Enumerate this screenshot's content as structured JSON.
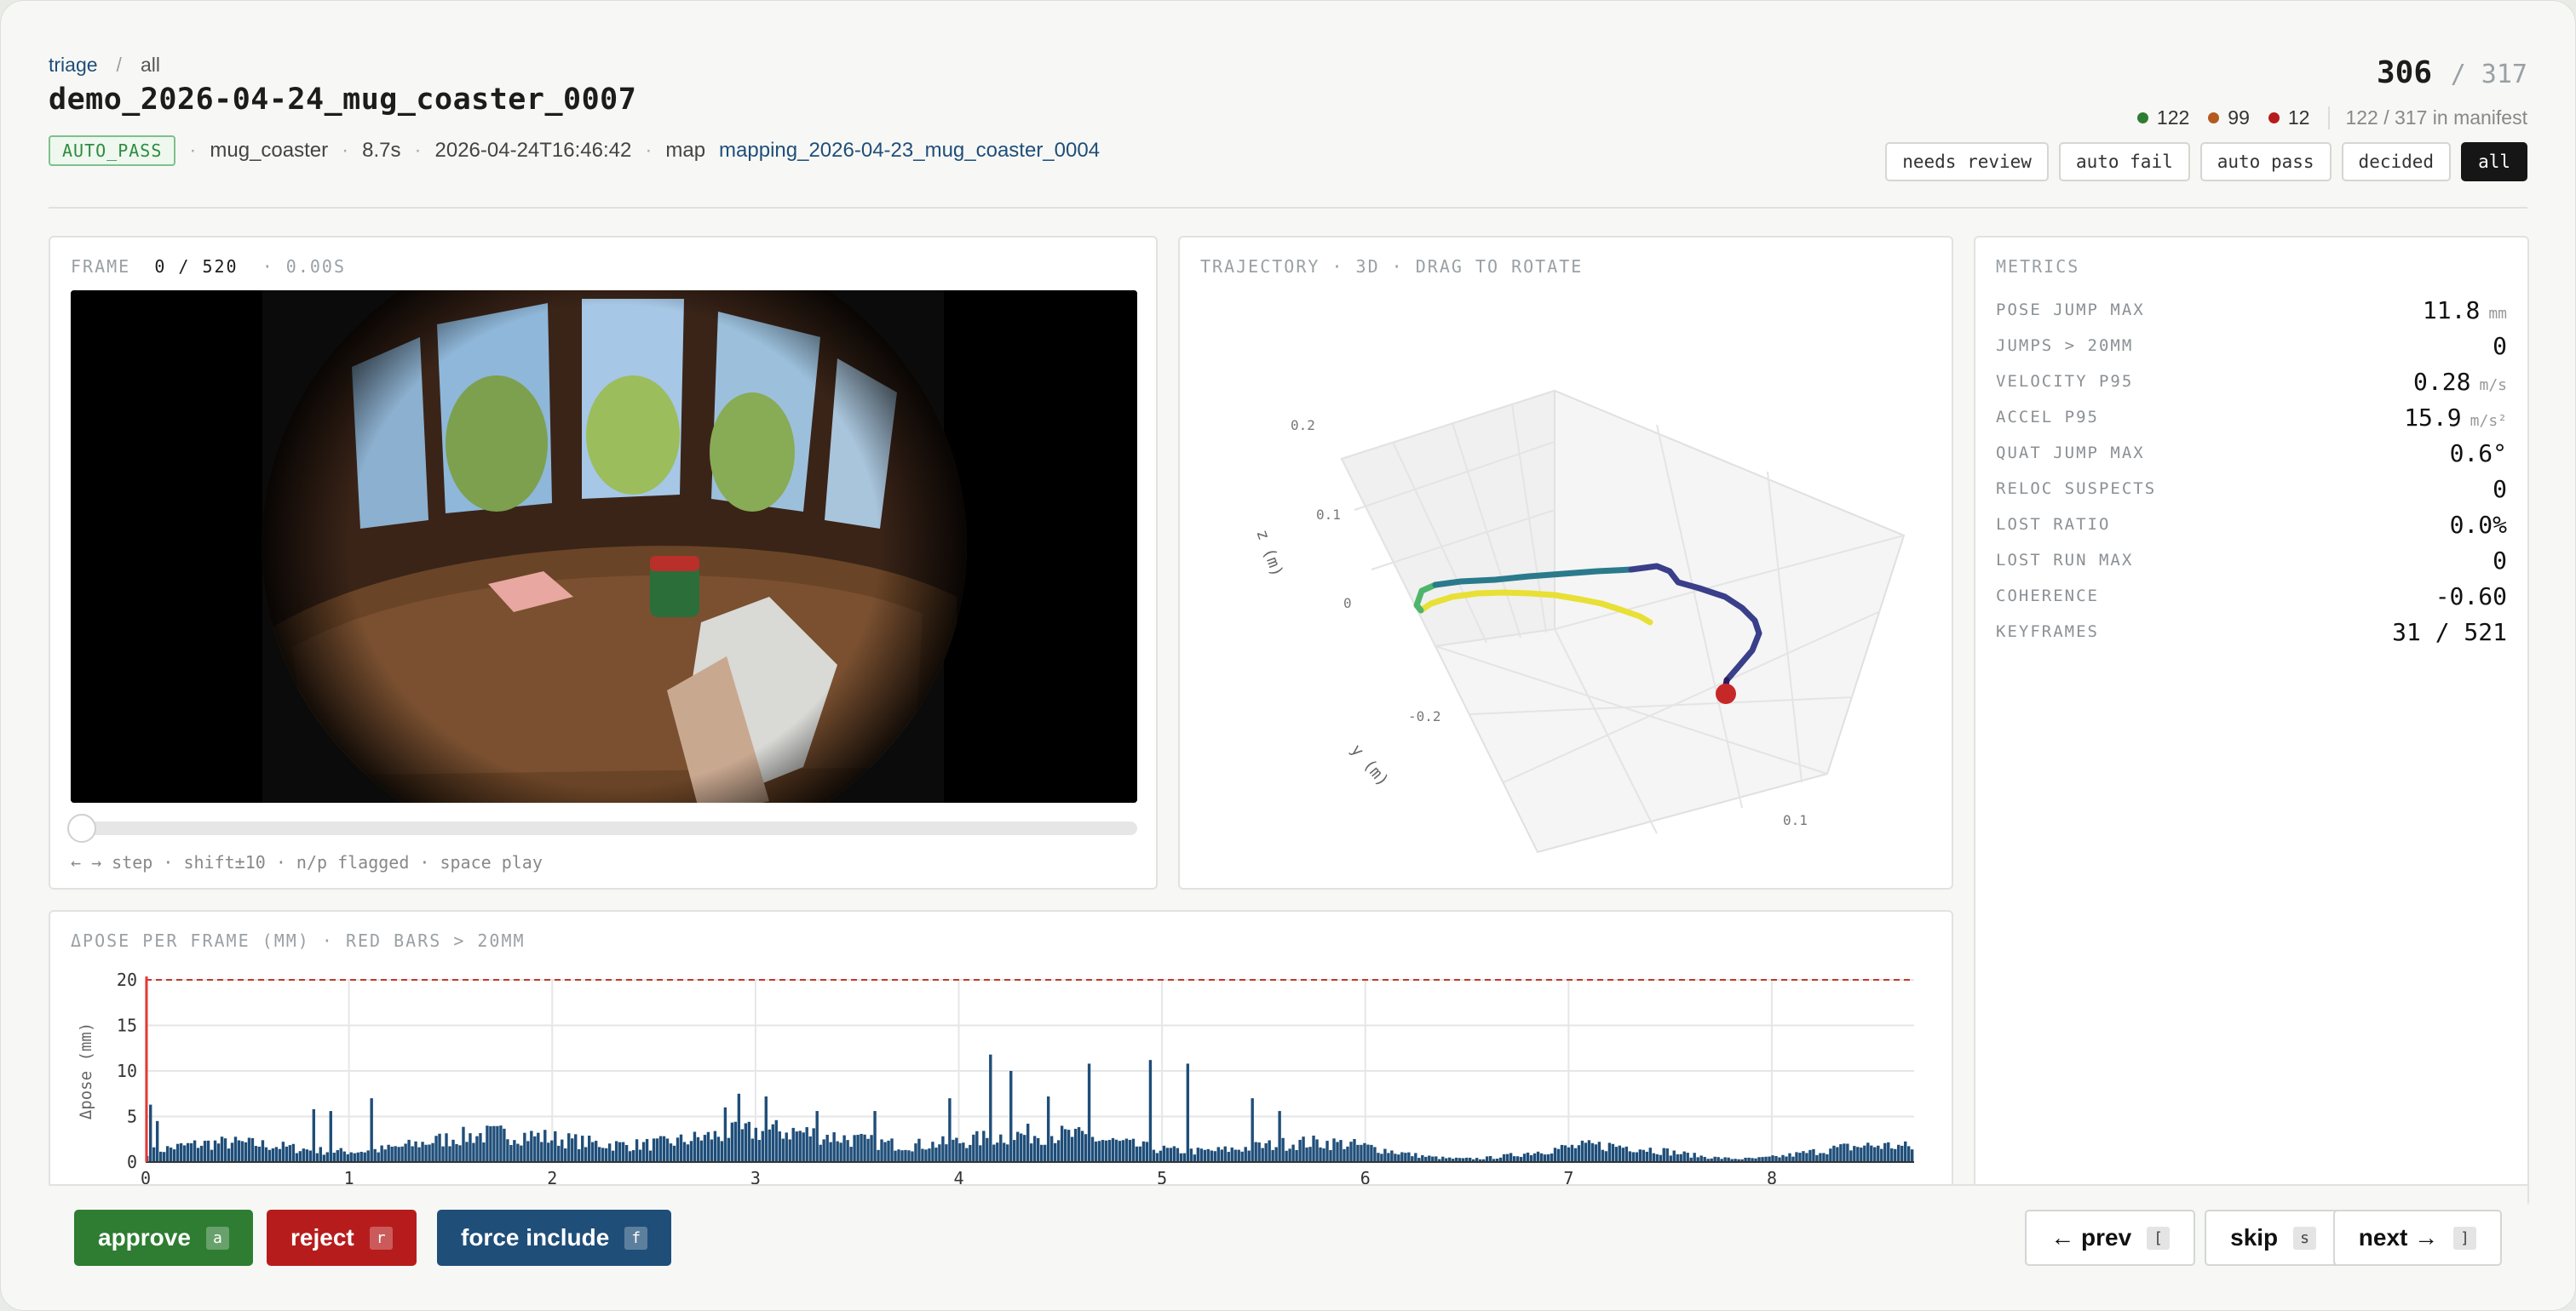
{
  "breadcrumb": {
    "root": "triage",
    "separator": "/",
    "current": "all"
  },
  "title": "demo_2026-04-24_mug_coaster_0007",
  "meta": {
    "badge": "AUTO_PASS",
    "task": "mug_coaster",
    "duration": "8.7s",
    "timestamp": "2026-04-24T16:46:42",
    "map_label": "map",
    "map_value": "mapping_2026-04-23_mug_coaster_0004"
  },
  "counter": {
    "current": "306",
    "total": "/ 317"
  },
  "stats": {
    "pass": "122",
    "fail": "99",
    "reject": "12",
    "manifest": "122 / 317 in manifest",
    "colors": {
      "pass": "#2e7d32",
      "fail": "#b35a1f",
      "reject": "#b71c1c"
    }
  },
  "filters": [
    "needs review",
    "auto fail",
    "auto pass",
    "decided",
    "all"
  ],
  "frame": {
    "label": "FRAME",
    "index": "0 / 520",
    "time": "· 0.00S",
    "hint": "← → step · shift±10 · n/p flagged · space play"
  },
  "trajectory": {
    "label": "TRAJECTORY · 3D · DRAG TO ROTATE",
    "zlabel": "z (m)",
    "ylabel": "y (m)",
    "ticks": [
      "0.2",
      "0.1",
      "0",
      "-0.2",
      "0.1"
    ]
  },
  "metrics": {
    "label": "METRICS",
    "rows": [
      {
        "name": "POSE JUMP MAX",
        "value": "11.8",
        "unit": "mm"
      },
      {
        "name": "JUMPS > 20MM",
        "value": "0",
        "unit": ""
      },
      {
        "name": "VELOCITY P95",
        "value": "0.28",
        "unit": "m/s"
      },
      {
        "name": "ACCEL P95",
        "value": "15.9",
        "unit": "m/s²"
      },
      {
        "name": "QUAT JUMP MAX",
        "value": "0.6°",
        "unit": ""
      },
      {
        "name": "RELOC SUSPECTS",
        "value": "0",
        "unit": ""
      },
      {
        "name": "LOST RATIO",
        "value": "0.0%",
        "unit": ""
      },
      {
        "name": "LOST RUN MAX",
        "value": "0",
        "unit": ""
      },
      {
        "name": "COHERENCE",
        "value": "-0.60",
        "unit": ""
      },
      {
        "name": "KEYFRAMES",
        "value": "31 / 521",
        "unit": ""
      }
    ]
  },
  "pose_chart": {
    "label": "ΔPOSE PER FRAME (MM) · RED BARS > 20MM",
    "ylabel": "Δpose (mm)",
    "threshold": 20
  },
  "chart_data": {
    "type": "bar",
    "title": "ΔPOSE PER FRAME (MM) · RED BARS > 20MM",
    "xlabel": "",
    "ylabel": "Δpose (mm)",
    "xlim": [
      0,
      8.7
    ],
    "ylim": [
      0,
      20
    ],
    "xticks": [
      "0",
      "1",
      "2",
      "3",
      "4",
      "5",
      "6",
      "7",
      "8"
    ],
    "yticks": [
      "0",
      "5",
      "10",
      "15",
      "20"
    ],
    "threshold": 20,
    "grid": true,
    "bar_color": "#1f4e79",
    "threshold_color": "#c0392b",
    "spikes": [
      {
        "x": 0.02,
        "y": 6.3
      },
      {
        "x": 0.05,
        "y": 4.5
      },
      {
        "x": 0.82,
        "y": 5.8
      },
      {
        "x": 0.9,
        "y": 5.6
      },
      {
        "x": 1.1,
        "y": 7.0
      },
      {
        "x": 2.85,
        "y": 6.0
      },
      {
        "x": 2.92,
        "y": 7.5
      },
      {
        "x": 3.05,
        "y": 7.2
      },
      {
        "x": 3.3,
        "y": 5.6
      },
      {
        "x": 3.58,
        "y": 5.6
      },
      {
        "x": 3.95,
        "y": 7.0
      },
      {
        "x": 4.15,
        "y": 11.8
      },
      {
        "x": 4.25,
        "y": 10.0
      },
      {
        "x": 4.45,
        "y": 7.2
      },
      {
        "x": 4.65,
        "y": 10.8
      },
      {
        "x": 4.95,
        "y": 11.2
      },
      {
        "x": 5.13,
        "y": 10.8
      },
      {
        "x": 5.45,
        "y": 7.0
      },
      {
        "x": 5.58,
        "y": 5.6
      }
    ]
  },
  "actions": {
    "approve": {
      "label": "approve",
      "key": "a",
      "color": "#2e7d32"
    },
    "reject": {
      "label": "reject",
      "key": "r",
      "color": "#b71c1c"
    },
    "force": {
      "label": "force include",
      "key": "f",
      "color": "#1f4e79"
    },
    "prev": {
      "label": "← prev",
      "key": "["
    },
    "skip": {
      "label": "skip",
      "key": "s"
    },
    "next": {
      "label": "next →",
      "key": "]"
    }
  }
}
